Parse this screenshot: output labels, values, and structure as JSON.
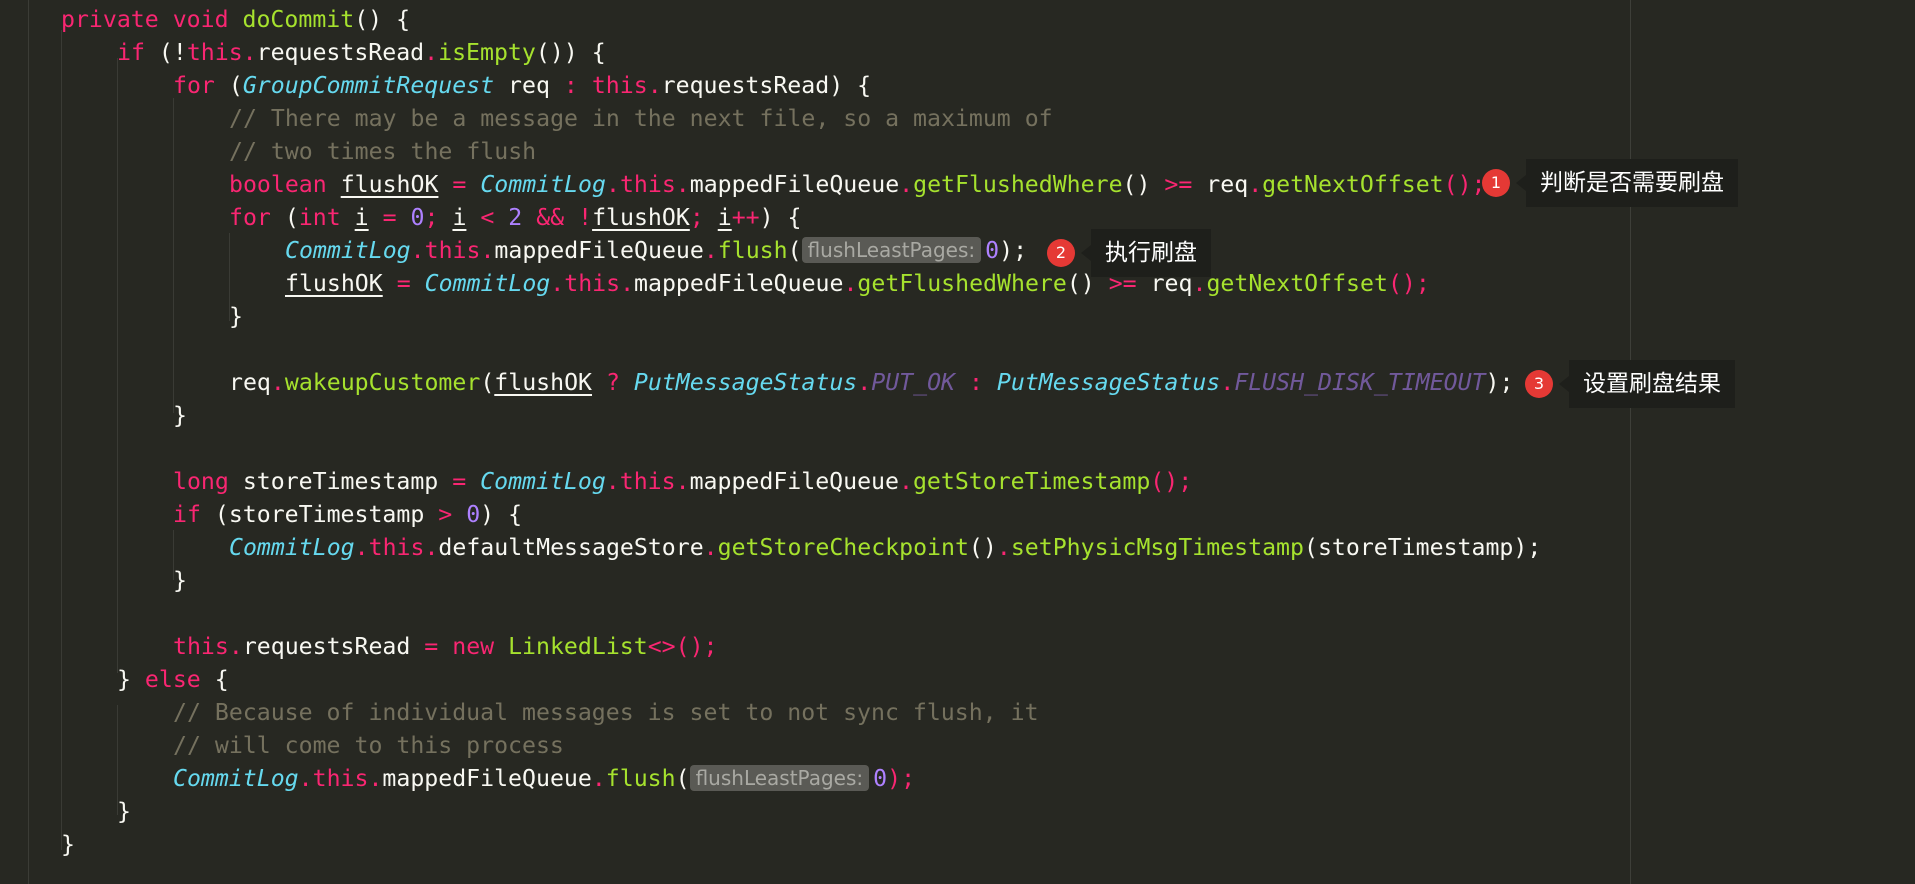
{
  "editor": {
    "colors": {
      "background": "#272822",
      "keyword": "#f92672",
      "type": "#66d9ef",
      "function": "#a6e22e",
      "comment": "#75715e",
      "number": "#ae81ff",
      "text": "#f8f8f2",
      "badge": "#e53935"
    },
    "hints": {
      "flush_param": "flushLeastPages:"
    },
    "code": {
      "sig_private": "private",
      "sig_void": "void",
      "sig_name": "doCommit",
      "sig_rest": "() {",
      "if1_kw": "if",
      "if1_open": " (!",
      "this": "this",
      "dot": ".",
      "requestsRead": "requestsRead",
      "isEmpty": "isEmpty",
      "if1_close": "()) {",
      "for_kw": "for",
      "for_open": " (",
      "GroupCommitRequest": "GroupCommitRequest",
      "req_sp": " req ",
      "colon": ":",
      "sp": " ",
      "for_close": ") {",
      "comment1": "// There may be a message in the next file, so a maximum of",
      "comment2": "// two times the flush",
      "boolean": "boolean",
      "flushOK": "flushOK",
      "assign": " = ",
      "CommitLog": "CommitLog",
      "mappedFileQueue": "mappedFileQueue",
      "getFlushedWhere": "getFlushedWhere",
      "parens": "()",
      "ge": " >= ",
      "req": "req",
      "getNextOffset": "getNextOffset",
      "end_call": "();",
      "for2_open": " (",
      "int": "int",
      "i": "i",
      "zero": "0",
      "semi": ";",
      "lt": " < ",
      "two": "2",
      "and": " && ",
      "bang": "!",
      "inc": "++",
      "for2_close": ") {",
      "flush": "flush",
      "paren_open": "(",
      "flush_close": ");",
      "close_brace": "}",
      "wakeupCustomer": "wakeupCustomer",
      "qmark": " ? ",
      "PutMessageStatus": "PutMessageStatus",
      "PUT_OK": "PUT_OK",
      "colon_sp": " : ",
      "FLUSH_DISK_TIMEOUT": "FLUSH_DISK_TIMEOUT",
      "long": "long",
      "storeTimestamp": "storeTimestamp",
      "getStoreTimestamp": "getStoreTimestamp",
      "if2_open": " (",
      "gt": " > ",
      "if2_close": ") {",
      "defaultMessageStore": "defaultMessageStore",
      "getStoreCheckpoint": "getStoreCheckpoint",
      "setPhysicMsgTimestamp": "setPhysicMsgTimestamp",
      "call_open": "(",
      "new": "new",
      "LinkedList": "LinkedList",
      "diamond": "<>",
      "else_close": "} ",
      "else": "else",
      "open_brace": " {",
      "comment3": "// Because of individual messages is set to not sync flush, it",
      "comment4": "// will come to this process"
    }
  },
  "annotations": [
    {
      "num": "1",
      "text": "判断是否需要刷盘"
    },
    {
      "num": "2",
      "text": "执行刷盘"
    },
    {
      "num": "3",
      "text": "设置刷盘结果"
    }
  ]
}
